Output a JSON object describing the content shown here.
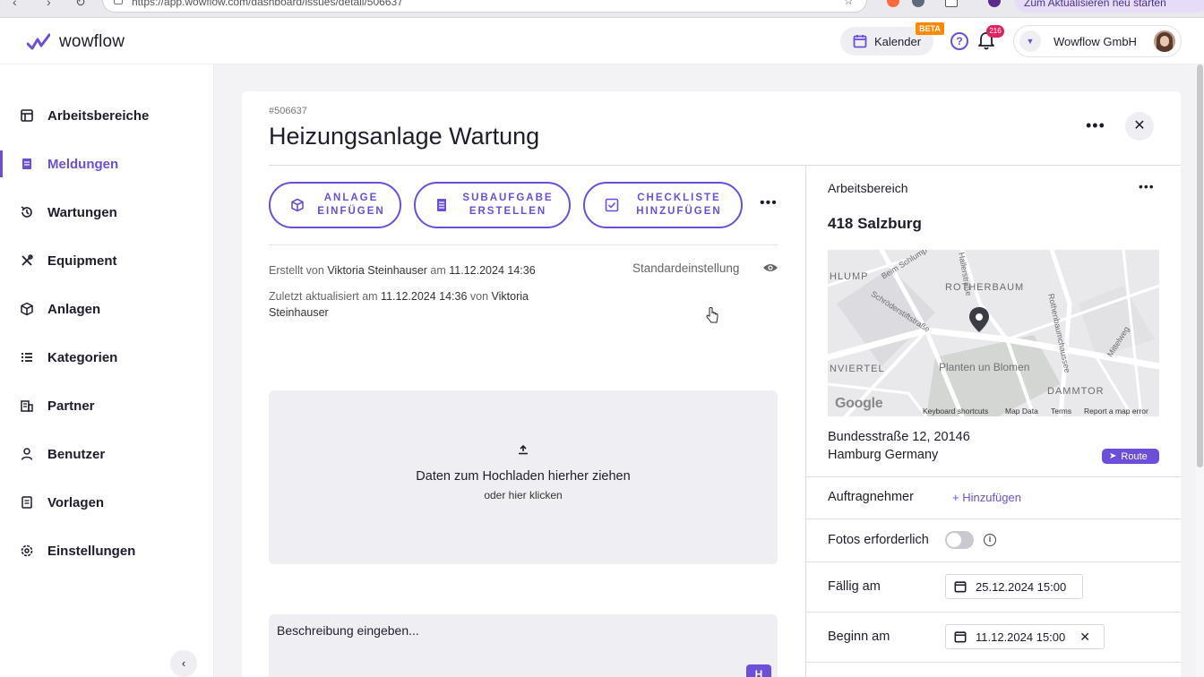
{
  "browser": {
    "url": "https://app.wowflow.com/dashboard/issues/detail/506637",
    "update_label": "Zum Aktualisieren neu starten"
  },
  "header": {
    "logo_text": "wowflow",
    "calendar_label": "Kalender",
    "beta_label": "BETA",
    "help_glyph": "?",
    "notification_count": "216",
    "account_name": "Wowflow GmbH"
  },
  "sidebar": {
    "items": [
      {
        "label": "Arbeitsbereiche",
        "icon": "workspace-icon"
      },
      {
        "label": "Meldungen",
        "icon": "reports-icon",
        "active": true
      },
      {
        "label": "Wartungen",
        "icon": "maintenance-icon"
      },
      {
        "label": "Equipment",
        "icon": "tools-icon"
      },
      {
        "label": "Anlagen",
        "icon": "cube-icon"
      },
      {
        "label": "Kategorien",
        "icon": "list-icon"
      },
      {
        "label": "Partner",
        "icon": "building-icon"
      },
      {
        "label": "Benutzer",
        "icon": "user-icon"
      },
      {
        "label": "Vorlagen",
        "icon": "template-icon"
      },
      {
        "label": "Einstellungen",
        "icon": "settings-icon"
      }
    ],
    "collapse_glyph": "‹"
  },
  "issue": {
    "number": "#506637",
    "title": "Heizungsanlage Wartung",
    "actions": [
      {
        "line1": "ANLAGE",
        "line2": "EINFÜGEN",
        "icon": "cube-icon"
      },
      {
        "line1": "SUBAUFGABE",
        "line2": "ERSTELLEN",
        "icon": "document-icon"
      },
      {
        "line1": "CHECKLISTE",
        "line2": "HINZUFÜGEN",
        "icon": "checklist-icon"
      }
    ],
    "created_prefix": "Erstellt von ",
    "created_by": "Viktoria Steinhauser",
    "created_mid": " am ",
    "created_at": "11.12.2024 14:36",
    "updated_prefix": "Zuletzt aktualisiert am ",
    "updated_at": "11.12.2024 14:36",
    "updated_mid": " von ",
    "updated_by": "Viktoria Steinhauser",
    "visibility_label": "Standardeinstellung",
    "upload_title": "Daten zum Hochladen hierher ziehen",
    "upload_sub": "oder hier klicken",
    "description_placeholder": "Beschreibung eingeben...",
    "format_button": "H"
  },
  "panel": {
    "workspace_label": "Arbeitsbereich",
    "workspace_name": "418 Salzburg",
    "map": {
      "labels": [
        "HLUMP",
        "ROTHERBAUM",
        "NVIERTEL",
        "Planten un Blomen",
        "DAMMTOR"
      ],
      "street_labels": [
        "Beim Schlump",
        "Schröderstiftstraße",
        "Rothenbaumchaussee",
        "Mittelweg",
        "Hallerstraße"
      ],
      "logo": "Google",
      "footer": [
        "Keyboard shortcuts",
        "Map Data",
        "Terms",
        "Report a map error"
      ]
    },
    "address_line1": "Bundesstraße 12, 20146",
    "address_line2": "Hamburg Germany",
    "route_label": "Route",
    "assignee_label": "Auftragnehmer",
    "assignee_add": "+ Hinzufügen",
    "photos_label": "Fotos erforderlich",
    "photos_required": false,
    "due_label": "Fällig am",
    "due_value": "25.12.2024 15:00",
    "start_label": "Beginn am",
    "start_value": "11.12.2024 15:00"
  },
  "colors": {
    "accent": "#6c4ed9",
    "beta": "#ff8a00",
    "badge": "#e0245e"
  }
}
